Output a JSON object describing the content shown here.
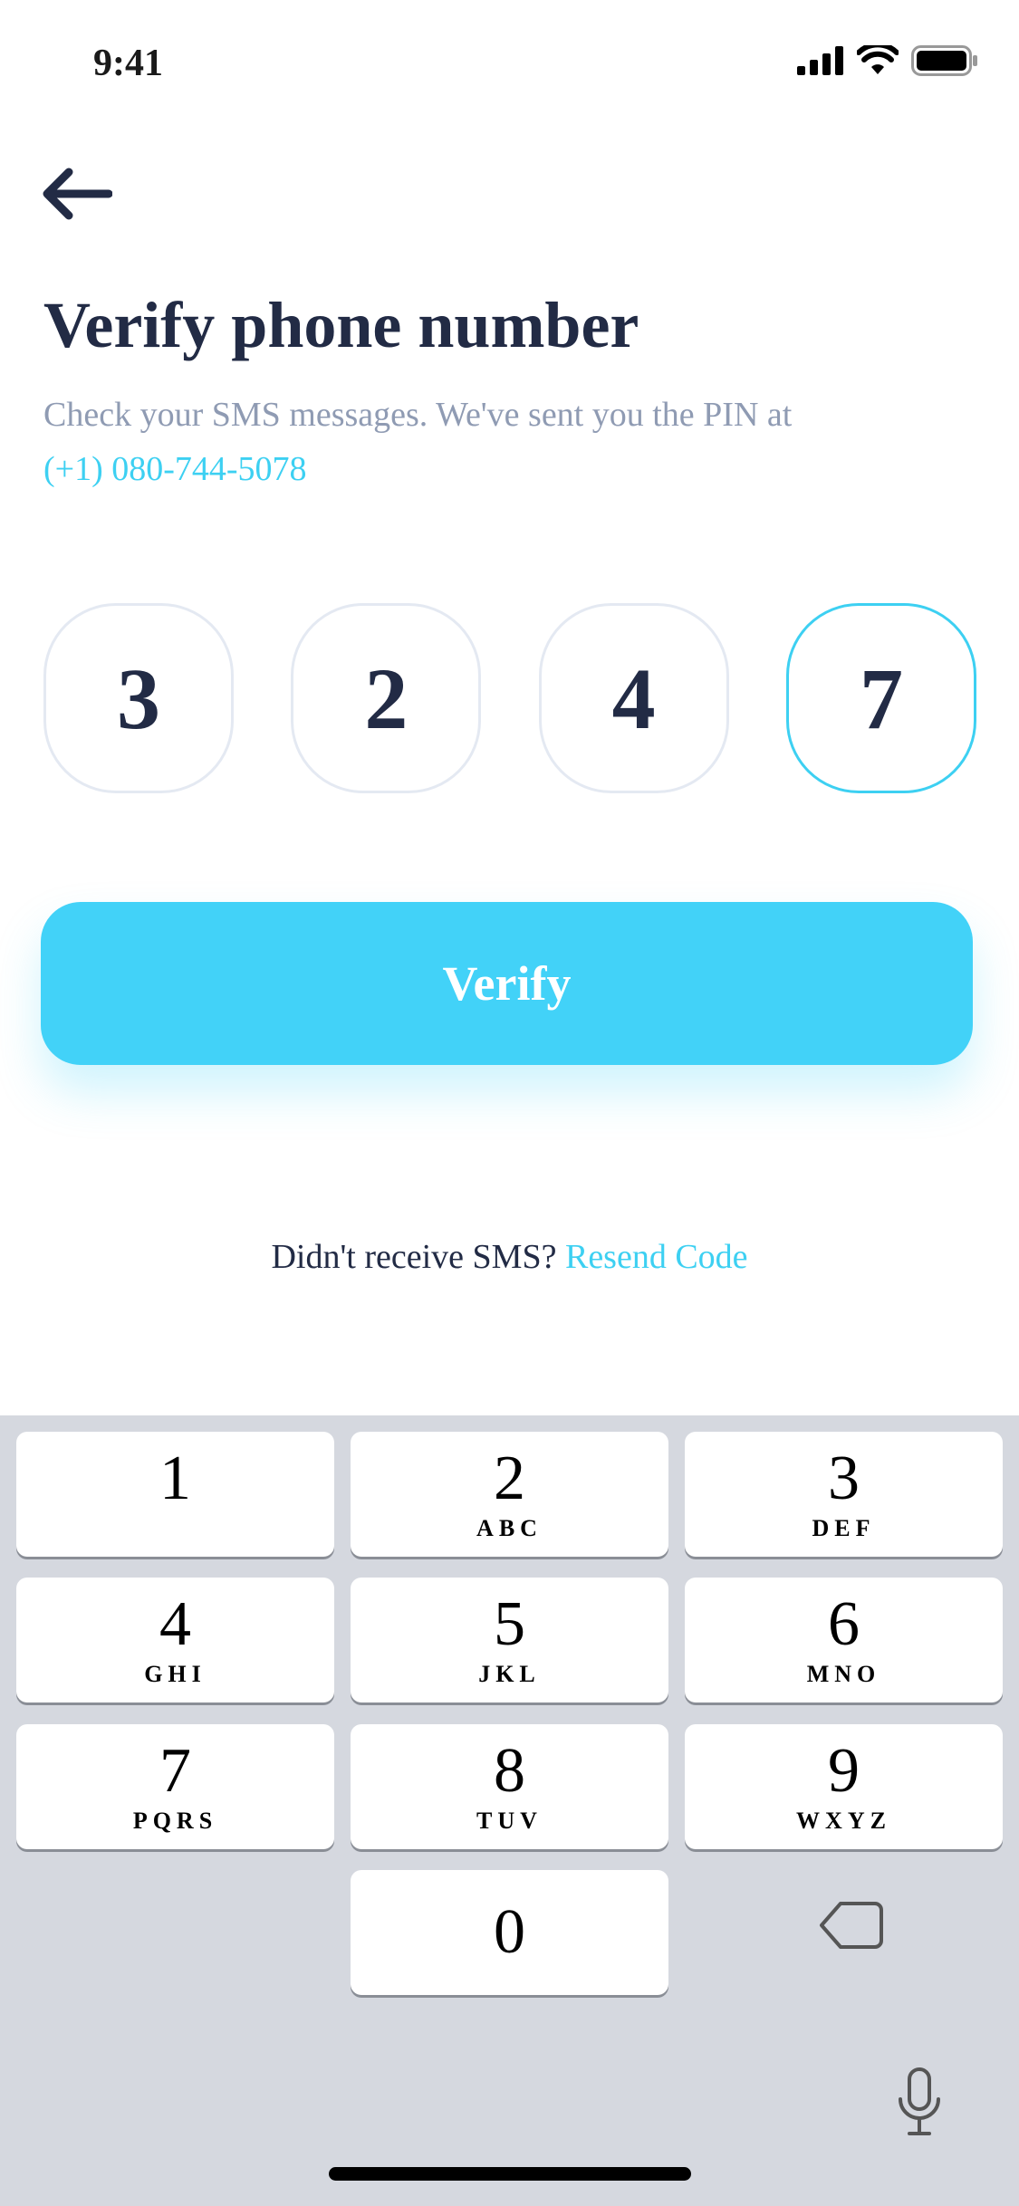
{
  "status_bar": {
    "time": "9:41",
    "icons": [
      "signal-icon",
      "wifi-icon",
      "battery-icon"
    ]
  },
  "header": {
    "back_icon": "back-arrow-icon",
    "title": "Verify phone number",
    "subtitle": "Check your SMS messages. We've sent you the PIN at",
    "phone_number": "(+1) 080-744-5078"
  },
  "pin": {
    "digits": [
      "3",
      "2",
      "4",
      "7"
    ],
    "active_index": 3
  },
  "verify_button": {
    "label": "Verify"
  },
  "resend": {
    "prompt": "Didn't receive SMS?",
    "link": "Resend Code"
  },
  "keyboard": {
    "keys": [
      {
        "num": "1",
        "letters": ""
      },
      {
        "num": "2",
        "letters": "ABC"
      },
      {
        "num": "3",
        "letters": "DEF"
      },
      {
        "num": "4",
        "letters": "GHI"
      },
      {
        "num": "5",
        "letters": "JKL"
      },
      {
        "num": "6",
        "letters": "MNO"
      },
      {
        "num": "7",
        "letters": "PQRS"
      },
      {
        "num": "8",
        "letters": "TUV"
      },
      {
        "num": "9",
        "letters": "WXYZ"
      },
      {
        "num": "0",
        "letters": ""
      }
    ],
    "delete_icon": "delete-icon",
    "mic_icon": "microphone-icon"
  },
  "colors": {
    "accent": "#42d2f8",
    "link": "#3dd0f2",
    "text_dark": "#222b45",
    "text_muted": "#8f9bb3",
    "keyboard_bg": "#d5d8df"
  }
}
